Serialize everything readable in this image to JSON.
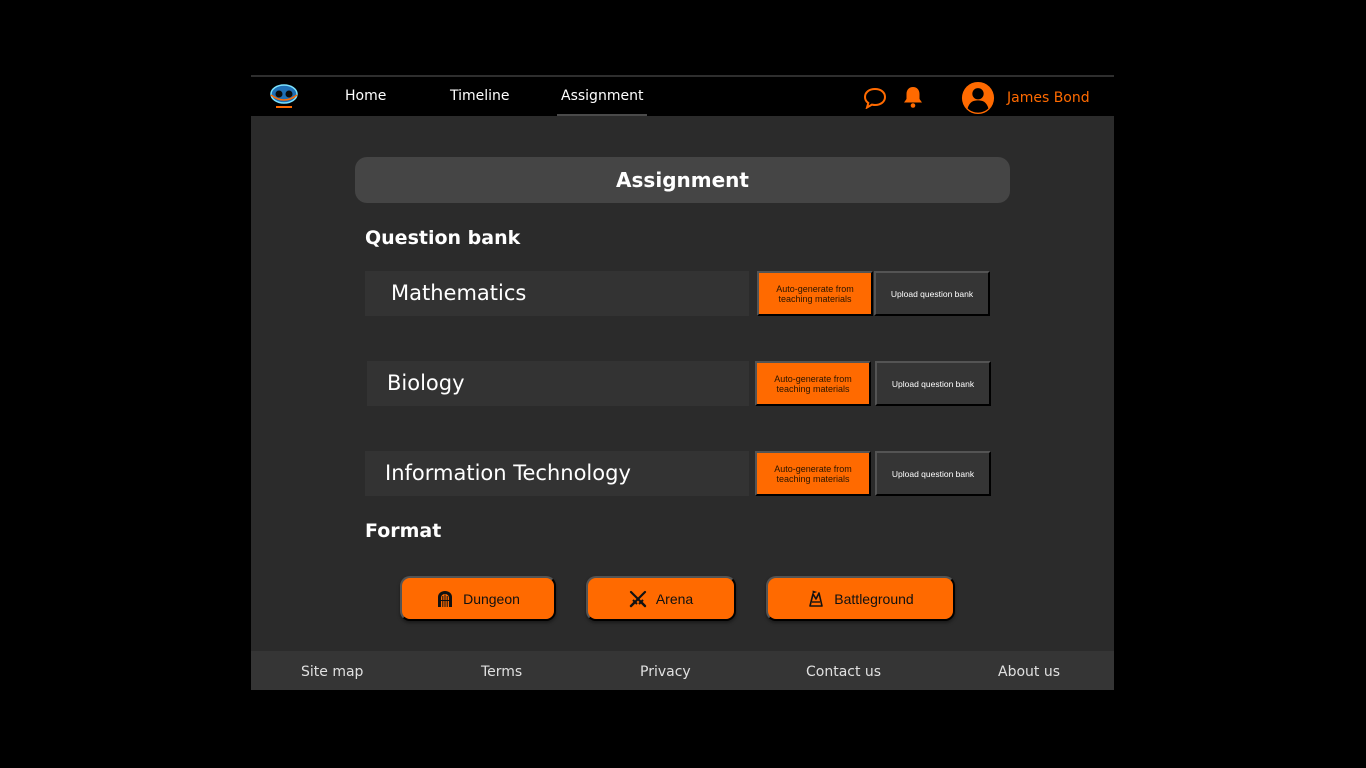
{
  "nav": {
    "items": [
      {
        "label": "Home"
      },
      {
        "label": "Timeline"
      },
      {
        "label": "Assignment",
        "active": true
      }
    ],
    "icons": {
      "chat": "chat-bubble-icon",
      "notifications": "bell-icon",
      "avatar": "user-avatar-icon"
    },
    "user_name": "James Bond"
  },
  "page_title": "Assignment",
  "question_bank": {
    "label": "Question bank",
    "subjects": [
      {
        "name": "Mathematics",
        "auto_label": "Auto-generate from teaching materials",
        "upload_label": "Upload question bank"
      },
      {
        "name": "Biology",
        "auto_label": "Auto-generate from teaching materials",
        "upload_label": "Upload question bank"
      },
      {
        "name": "Information Technology",
        "auto_label": "Auto-generate from teaching materials",
        "upload_label": "Upload question bank"
      }
    ]
  },
  "format": {
    "label": "Format",
    "options": [
      {
        "label": "Dungeon",
        "icon": "dungeon-gate-icon"
      },
      {
        "label": "Arena",
        "icon": "crossed-swords-icon"
      },
      {
        "label": "Battleground",
        "icon": "battleground-icon"
      }
    ]
  },
  "footer": {
    "links": [
      {
        "label": "Site map"
      },
      {
        "label": "Terms"
      },
      {
        "label": "Privacy"
      },
      {
        "label": "Contact us"
      },
      {
        "label": "About us"
      }
    ]
  },
  "colors": {
    "accent": "#ff6a00",
    "background": "#2b2b2b",
    "header": "#000000",
    "panel": "#333333",
    "title_bar": "#454545"
  }
}
